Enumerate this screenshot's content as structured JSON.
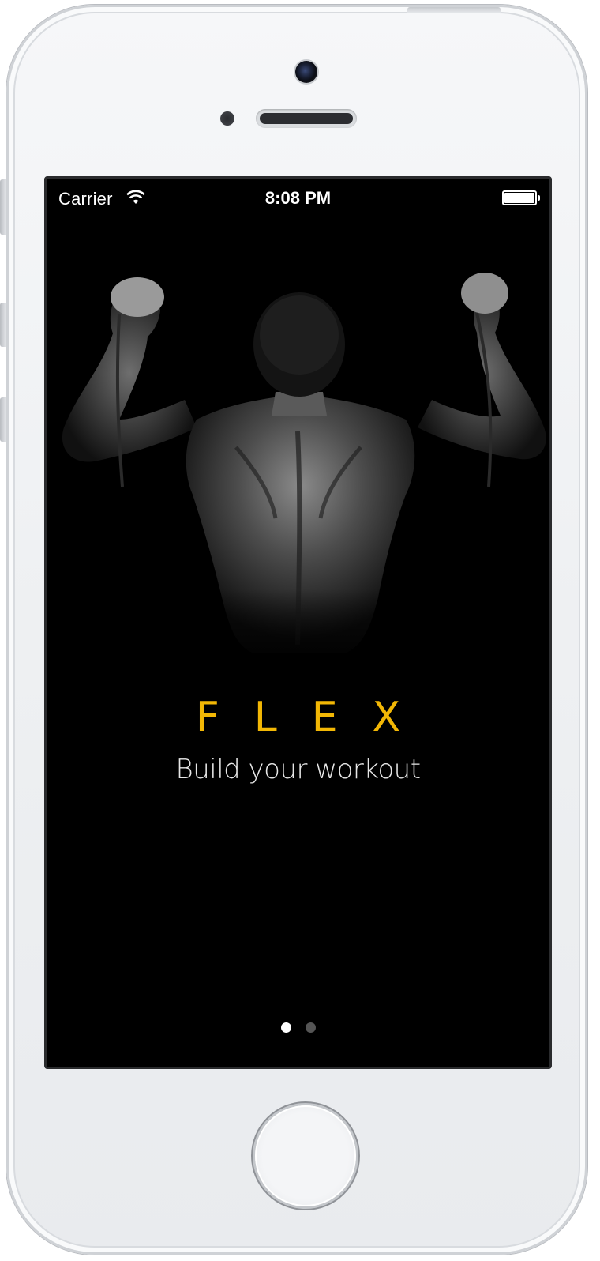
{
  "status_bar": {
    "carrier": "Carrier",
    "time": "8:08 PM",
    "battery_level": 1.0,
    "wifi_icon": "wifi-icon",
    "battery_icon": "battery-icon"
  },
  "splash": {
    "brand": "FLEX",
    "tagline": "Build your workout",
    "brand_color": "#F2B705",
    "background_color": "#000000",
    "hero_image": "flexing-athlete-back-photo"
  },
  "pager": {
    "page_count": 2,
    "current_page": 1
  },
  "device": {
    "frame": "iphone-white",
    "home_button_icon": "home-button"
  }
}
